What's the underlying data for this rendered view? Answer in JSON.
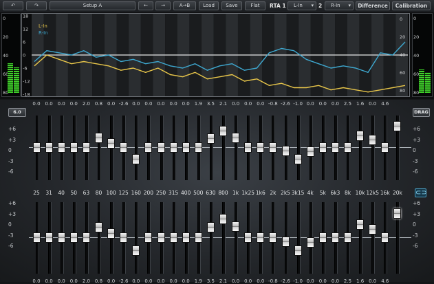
{
  "toolbar": {
    "undo_label": "↶",
    "redo_label": "↷",
    "setup_label": "Setup A",
    "prev_label": "←",
    "next_label": "→",
    "atob_label": "A→B",
    "load_label": "Load",
    "save_label": "Save",
    "flat_label": "Flat",
    "rta1_label": "RTA 1",
    "rta1_source": "L-In",
    "rta2_label": "2",
    "rta2_source": "R-In",
    "dropdown_arrow": "▾",
    "difference_label": "Difference",
    "calibration_label": "Calibration"
  },
  "meter_left": {
    "scale": [
      "0",
      "20",
      "40",
      "60",
      "80"
    ],
    "level_fraction": [
      0.38,
      0.33
    ]
  },
  "meter_right": {
    "scale": [
      "0",
      "20",
      "40",
      "60",
      "80"
    ],
    "level_fraction": [
      0.3,
      0.27
    ]
  },
  "rta": {
    "legend": [
      "L-In",
      "R-In"
    ],
    "colors": {
      "l": "#e8c64a",
      "r": "#3ea8d0"
    },
    "left_scale": [
      "18",
      "12",
      "6",
      "0",
      "-6",
      "-12",
      "-18"
    ],
    "right_scale": [
      "0",
      "20",
      "40",
      "60",
      "80"
    ],
    "chart_data": {
      "type": "line",
      "x_band_count": 31,
      "ylim": [
        -18,
        18
      ],
      "series": [
        {
          "name": "L-In",
          "values": [
            -5,
            0,
            -2,
            -4,
            -3,
            -4,
            -5,
            -7,
            -6,
            -8,
            -6,
            -9,
            -10,
            -8,
            -11,
            -10,
            -9,
            -12,
            -11,
            -14,
            -13,
            -15,
            -15,
            -14,
            -16,
            -15,
            -16,
            -17,
            -16,
            -15,
            -14
          ]
        },
        {
          "name": "R-In",
          "values": [
            -3,
            2,
            1,
            0,
            2,
            -1,
            0,
            -3,
            -2,
            -4,
            -3,
            -5,
            -6,
            -4,
            -7,
            -5,
            -4,
            -7,
            -6,
            1,
            3,
            2,
            -2,
            -4,
            -6,
            -5,
            -6,
            -8,
            1,
            0,
            6
          ]
        }
      ]
    }
  },
  "eq": {
    "gain_button": "6.0",
    "drag_button": "DRAG",
    "link_icon_label": "⊂⊃",
    "scale": [
      "+6",
      "+3",
      "0",
      "-3",
      "-6"
    ],
    "bands": [
      "25",
      "31",
      "40",
      "50",
      "63",
      "80",
      "100",
      "125",
      "160",
      "200",
      "250",
      "315",
      "400",
      "500",
      "630",
      "800",
      "1k",
      "1k25",
      "1k6",
      "2k",
      "2k5",
      "3k15",
      "4k",
      "5k",
      "6k3",
      "8k",
      "10k",
      "12k5",
      "16k",
      "20k"
    ],
    "top_values": [
      "0.0",
      "0.0",
      "0.0",
      "0.0",
      "2.0",
      "0.8",
      "0.0",
      "-2.6",
      "0.0",
      "0.0",
      "0.0",
      "0.0",
      "0.0",
      "1.9",
      "3.5",
      "2.1",
      "0.0",
      "0.0",
      "0.0",
      "-0.8",
      "-2.6",
      "-1.0",
      "0.0",
      "0.0",
      "0.0",
      "2.5",
      "1.6",
      "0.0",
      "4.6"
    ],
    "top_gains": [
      0,
      0,
      0,
      0,
      0,
      2.0,
      0.8,
      0,
      -2.6,
      0,
      0,
      0,
      0,
      0,
      1.9,
      3.5,
      2.1,
      0,
      0,
      0,
      -0.8,
      -2.6,
      -1.0,
      0,
      0,
      0,
      2.5,
      1.6,
      0,
      4.6
    ],
    "bottom_gains": [
      0,
      0,
      0,
      0,
      0,
      2.0,
      0.8,
      0,
      -2.6,
      0,
      0,
      0,
      0,
      0,
      1.9,
      3.5,
      2.1,
      0,
      0,
      0,
      -0.8,
      -2.6,
      -1.0,
      0,
      0,
      0,
      2.5,
      1.6,
      0,
      4.6
    ],
    "bottom_active_band": 29
  }
}
